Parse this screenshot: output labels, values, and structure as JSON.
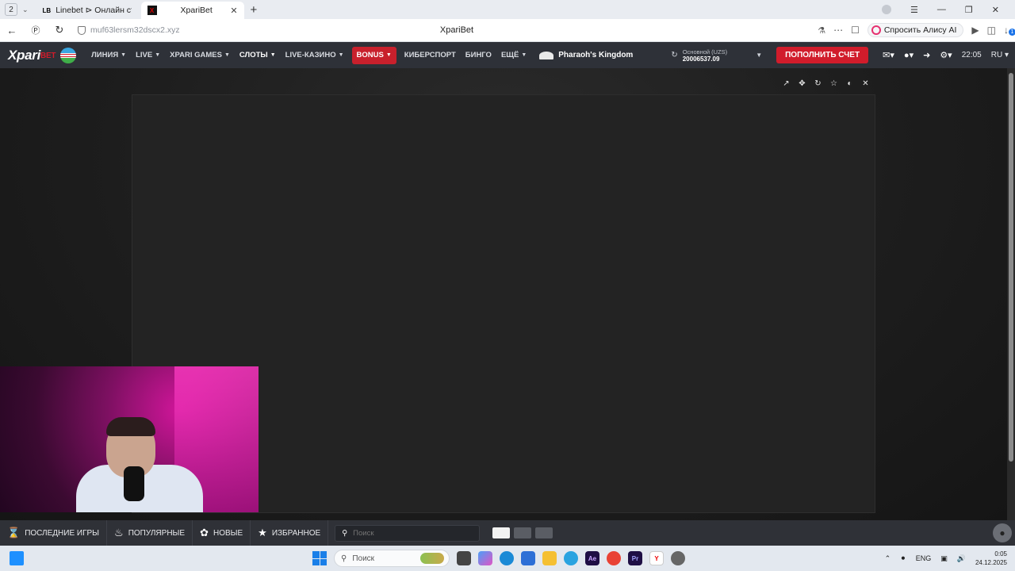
{
  "browser": {
    "tab_count": "2",
    "tabs": [
      {
        "favicon": "LB",
        "title": "Linebet ⊳ Онлайн ставки"
      },
      {
        "favicon": "X",
        "title": "XpariBet"
      }
    ],
    "url": "muf63lersm32dscx2.xyz",
    "page_title": "XpariBet",
    "alice_label": "Спросить Алису AI",
    "downloads_badge": "1"
  },
  "site": {
    "logo_main": "Xpari",
    "logo_suffix": "BET",
    "menu": [
      {
        "label": "ЛИНИЯ",
        "chevron": true
      },
      {
        "label": "LIVE",
        "chevron": true
      },
      {
        "label": "XPARI GAMES",
        "chevron": true
      },
      {
        "label": "СЛОТЫ",
        "chevron": true
      },
      {
        "label": "LIVE-КАЗИНО",
        "chevron": true
      },
      {
        "label": "BONUS",
        "chevron": true
      },
      {
        "label": "КИБЕРСПОРТ",
        "chevron": false
      },
      {
        "label": "БИНГО",
        "chevron": false
      },
      {
        "label": "ЕЩЁ",
        "chevron": true
      }
    ],
    "featured_game": "Pharaoh's Kingdom",
    "balance": {
      "account": "Основной (UZS)",
      "amount": "20006537.09"
    },
    "deposit_label": "ПОПОЛНИТЬ СЧЕТ",
    "time": "22:05",
    "language": "RU"
  },
  "gamebar": {
    "recent": "ПОСЛЕДНИЕ ИГРЫ",
    "popular": "ПОПУЛЯРНЫЕ",
    "new": "НОВЫЕ",
    "favorites": "ИЗБРАННОЕ",
    "search_placeholder": "Поиск"
  },
  "taskbar": {
    "search_placeholder": "Поиск",
    "language": "ENG",
    "time": "0:05",
    "date": "24.12.2025"
  },
  "colors": {
    "brand_red": "#d11c2b",
    "nav_bg": "#2e3138"
  }
}
